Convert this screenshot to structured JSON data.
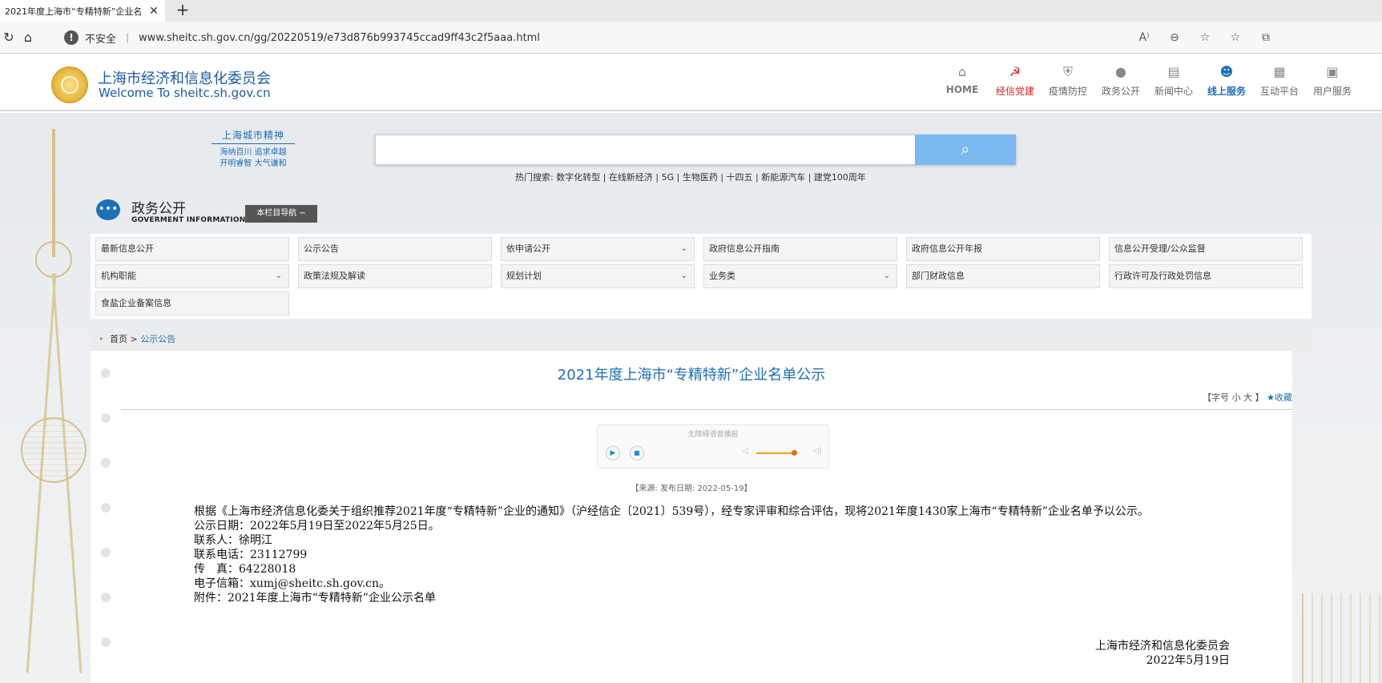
{
  "browser": {
    "tab_title": "2021年度上海市“专精特新”企业名",
    "new_tab": "+",
    "insecure_label": "不安全",
    "url": "www.sheitc.sh.gov.cn/gg/20220519/e73d876b993745ccad9ff43c2f5aaa.html"
  },
  "site": {
    "title": "上海市经济和信息化委员会",
    "subtitle": "Welcome To sheitc.sh.gov.cn",
    "nav": [
      {
        "label": "HOME",
        "icon": "home-icon"
      },
      {
        "label": "经信党建",
        "icon": "party-icon"
      },
      {
        "label": "疫情防控",
        "icon": "shield-icon"
      },
      {
        "label": "政务公开",
        "icon": "chat-icon"
      },
      {
        "label": "新闻中心",
        "icon": "book-icon"
      },
      {
        "label": "线上服务",
        "icon": "users-icon"
      },
      {
        "label": "互动平台",
        "icon": "grid-icon"
      },
      {
        "label": "用户服务",
        "icon": "user-service-icon"
      }
    ]
  },
  "spirit": {
    "title": "上海城市精神",
    "line1": "海纳百川 追求卓越",
    "line2": "开明睿智 大气谦和"
  },
  "search": {
    "placeholder": "",
    "hot": "热门搜索: 数字化转型 | 在线新经济 | 5G | 生物医药 | 十四五 | 新能源汽车 | 建党100周年"
  },
  "section": {
    "title": "政务公开",
    "subtitle": "GOVERMENT INFORMATION",
    "column_nav": "本栏目导航  −"
  },
  "menu": [
    {
      "label": "最新信息公开",
      "dropdown": false
    },
    {
      "label": "公示公告",
      "dropdown": false
    },
    {
      "label": "依申请公开",
      "dropdown": true
    },
    {
      "label": "政府信息公开指南",
      "dropdown": false
    },
    {
      "label": "政府信息公开年报",
      "dropdown": false
    },
    {
      "label": "信息公开受理/公众监督",
      "dropdown": false
    },
    {
      "label": "机构职能",
      "dropdown": true
    },
    {
      "label": "政策法规及解读",
      "dropdown": false
    },
    {
      "label": "规划计划",
      "dropdown": true
    },
    {
      "label": "业务类",
      "dropdown": true
    },
    {
      "label": "部门财政信息",
      "dropdown": false
    },
    {
      "label": "行政许可及行政处罚信息",
      "dropdown": false
    },
    {
      "label": "食盐企业备案信息",
      "dropdown": false
    }
  ],
  "breadcrumb": {
    "home": "首页",
    "sep": ">",
    "current": "公示公告"
  },
  "article": {
    "title": "2021年度上海市“专精特新”企业名单公示",
    "fontsize_label": "【字号   小     大  】",
    "favorite": "★收藏",
    "player_title": "无障碍语音播报",
    "meta": "【来源:   发布日期: 2022-05-19】",
    "para1": "根据《上海市经济信息化委关于组织推荐2021年度“专精特新”企业的通知》（沪经信企〔2021〕539号），经专家评审和综合评估，现将2021年度1430家上海市“专精特新”企业名单予以公示。",
    "lines": [
      "公示日期：2022年5月19日至2022年5月25日。",
      "联系人：徐明江",
      "联系电话：23112799",
      "传　真：64228018",
      "电子信箱：xumj@sheitc.sh.gov.cn。",
      "附件：2021年度上海市“专精特新”企业公示名单"
    ],
    "signer": "上海市经济和信息化委员会",
    "date": "2022年5月19日"
  }
}
